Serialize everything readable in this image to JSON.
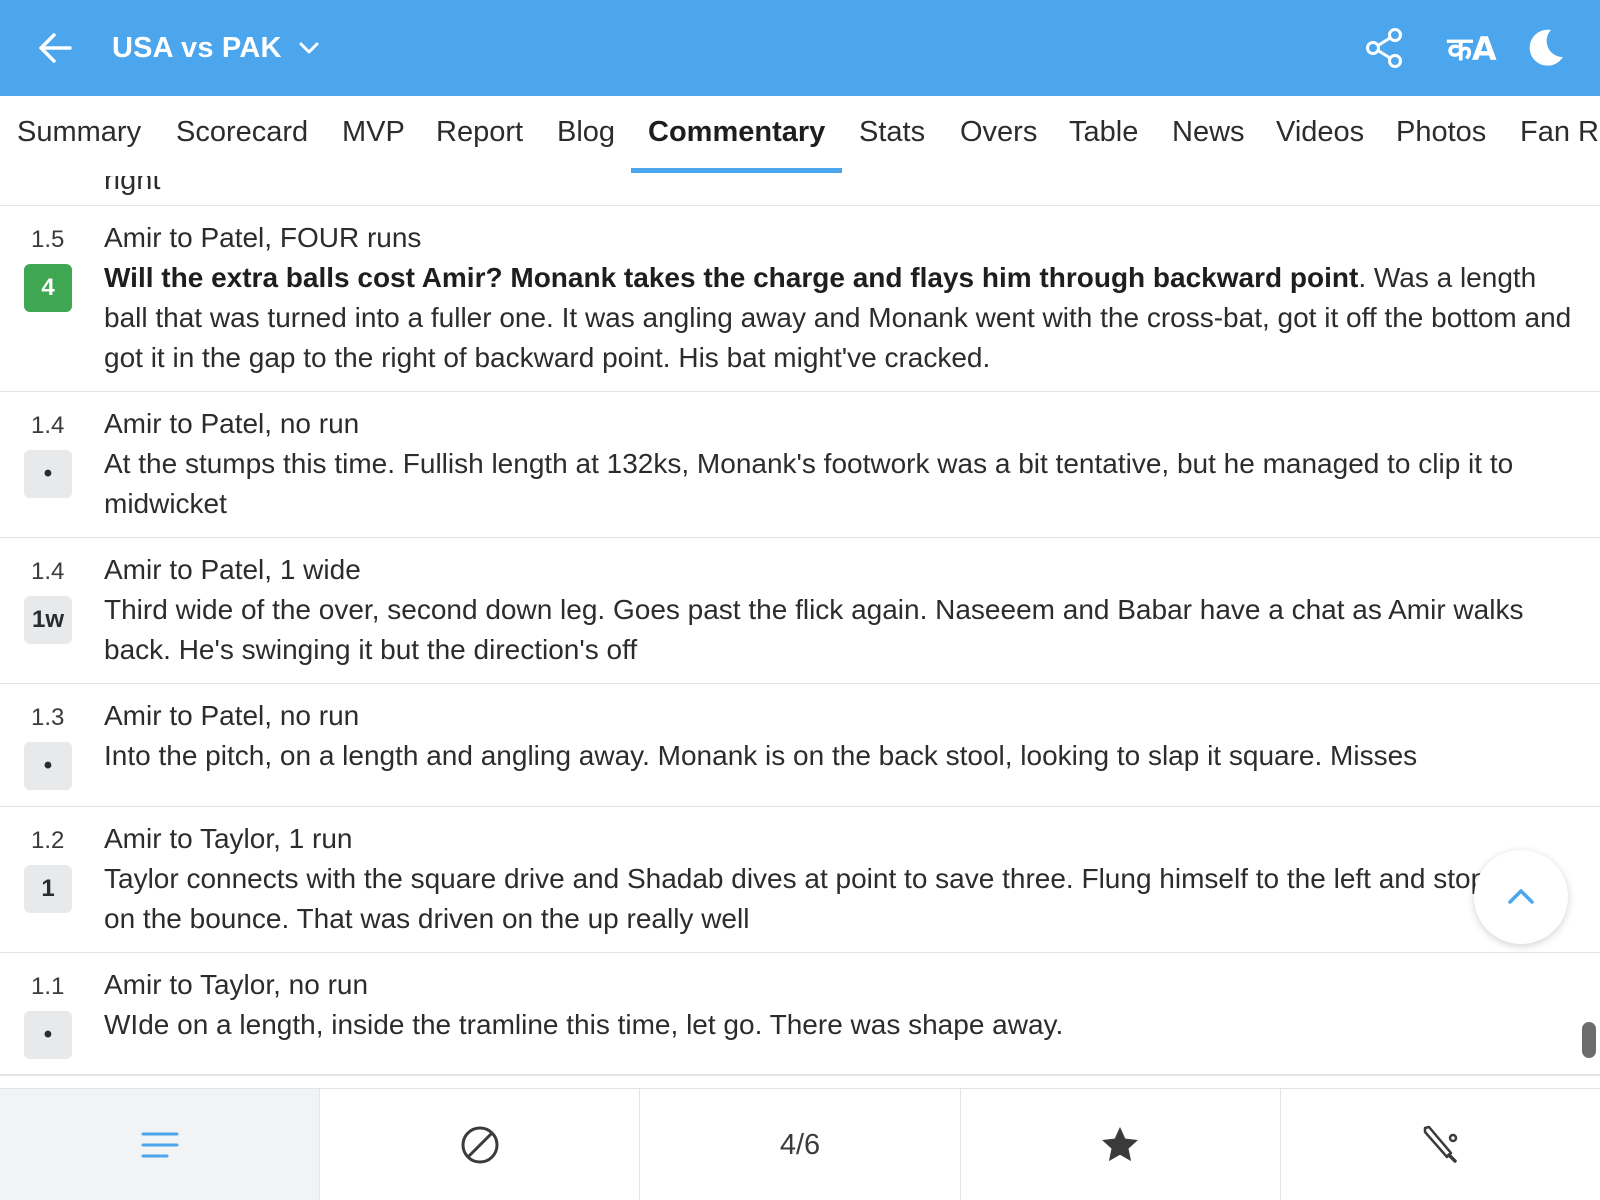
{
  "header": {
    "title": "USA vs PAK",
    "lang_label": "कA",
    "accent": "#4ba6ee"
  },
  "tabs": [
    {
      "label": "Summary"
    },
    {
      "label": "Scorecard"
    },
    {
      "label": "MVP"
    },
    {
      "label": "Report"
    },
    {
      "label": "Blog"
    },
    {
      "label": "Commentary",
      "active": true
    },
    {
      "label": "Stats"
    },
    {
      "label": "Overs"
    },
    {
      "label": "Table"
    },
    {
      "label": "News"
    },
    {
      "label": "Videos"
    },
    {
      "label": "Photos"
    },
    {
      "label": "Fan Ra"
    }
  ],
  "commentary": {
    "clipped_top_text": "right",
    "items": [
      {
        "over": "1.5",
        "badge": "4",
        "badge_type": "four",
        "headline": "Amir to Patel, FOUR runs",
        "bold_text": "Will the extra balls cost Amir? Monank takes the charge and flays him through backward point",
        "text": ". Was a length ball that was turned into a fuller one. It was angling away and Monank went with the cross-bat, got it off the bottom and got it in the gap to the right of backward point. His bat might've cracked."
      },
      {
        "over": "1.4",
        "badge": "•",
        "badge_type": "dot",
        "headline": "Amir to Patel, no run",
        "bold_text": "",
        "text": "At the stumps this time. Fullish length at 132ks, Monank's footwork was a bit tentative, but he managed to clip it to midwicket"
      },
      {
        "over": "1.4",
        "badge": "1w",
        "badge_type": "wide",
        "headline": "Amir to Patel, 1 wide",
        "bold_text": "",
        "text": "Third wide of the over, second down leg. Goes past the flick again. Naseeem and Babar have a chat as Amir walks back. He's swinging it but the direction's off"
      },
      {
        "over": "1.3",
        "badge": "•",
        "badge_type": "dot",
        "headline": "Amir to Patel, no run",
        "bold_text": "",
        "text": "Into the pitch, on a length and angling away. Monank is on the back stool, looking to slap it square. Misses"
      },
      {
        "over": "1.2",
        "badge": "1",
        "badge_type": "run",
        "headline": "Amir to Taylor, 1 run",
        "bold_text": "",
        "text": "Taylor connects with the square drive and Shadab dives at point to save three. Flung himself to the left and stopped it on the bounce. That was driven on the up really well"
      },
      {
        "over": "1.1",
        "badge": "•",
        "badge_type": "dot",
        "headline": "Amir to Taylor, no run",
        "bold_text": "",
        "text": "WIde on a length, inside the tramline this time, let go. There was shape away."
      }
    ]
  },
  "bottom_nav": {
    "items": [
      {
        "icon": "list-icon",
        "active": true
      },
      {
        "icon": "ball-icon"
      },
      {
        "label": "4/6",
        "icon": ""
      },
      {
        "icon": "star-icon"
      },
      {
        "icon": "bat-icon"
      }
    ]
  }
}
